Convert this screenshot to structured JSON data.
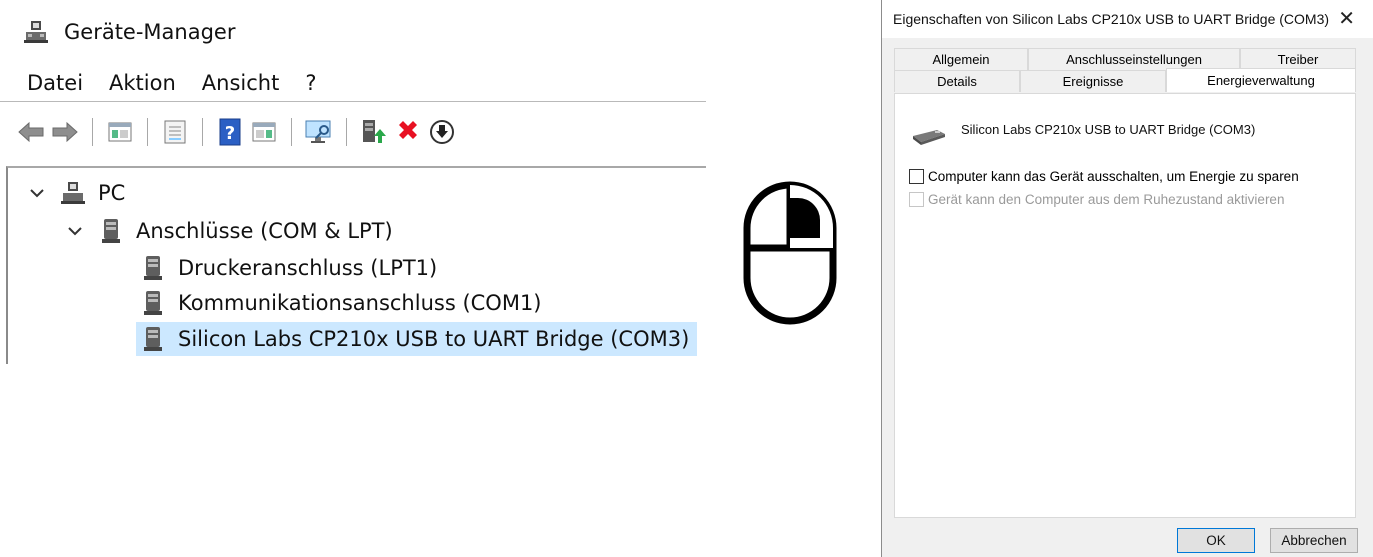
{
  "device_manager": {
    "title": "Geräte-Manager",
    "menu": [
      "Datei",
      "Aktion",
      "Ansicht",
      "?"
    ],
    "tree": {
      "root": "PC",
      "category": "Anschlüsse (COM & LPT)",
      "items": [
        "Druckeranschluss (LPT1)",
        "Kommunikationsanschluss (COM1)",
        "Silicon Labs CP210x USB to UART Bridge (COM3)"
      ],
      "selected_index": 2
    }
  },
  "dialog": {
    "title": "Eigenschaften von Silicon Labs CP210x USB to UART Bridge (COM3)",
    "close_glyph": "✕",
    "tabs_row1": [
      "Allgemein",
      "Anschlusseinstellungen",
      "Treiber"
    ],
    "tabs_row2": [
      "Details",
      "Ereignisse",
      "Energieverwaltung"
    ],
    "active_tab": "Energieverwaltung",
    "device_name": "Silicon Labs CP210x USB to UART Bridge (COM3)",
    "options": [
      {
        "label": "Computer kann das Gerät ausschalten, um Energie zu sparen",
        "checked": false,
        "enabled": true
      },
      {
        "label": "Gerät kann den Computer aus dem Ruhezustand aktivieren",
        "checked": false,
        "enabled": false
      }
    ],
    "ok_label": "OK",
    "cancel_label": "Abbrechen"
  },
  "icons": {
    "title": "device-manager-icon",
    "toolbar": [
      "back-arrow-icon",
      "forward-arrow-icon",
      "show-hide-console-tree-icon",
      "properties-icon",
      "help-icon",
      "action-pane-icon",
      "scan-hardware-icon",
      "update-driver-icon",
      "uninstall-icon",
      "disable-device-icon"
    ],
    "mouse": "mouse-right-click-icon",
    "port": "port-icon",
    "pc": "computer-icon",
    "device": "usb-device-icon"
  },
  "colors": {
    "selection": "#cce8ff",
    "uninstall_red": "#e81123",
    "dialog_bg": "#f0f0f0",
    "default_button_border": "#0078d7"
  }
}
